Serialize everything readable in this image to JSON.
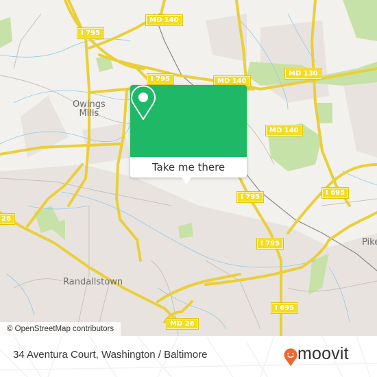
{
  "map": {
    "place_labels": [
      {
        "id": "owings-mills",
        "text": "Owings\nMills"
      },
      {
        "id": "randallstown",
        "text": "Randallstown"
      },
      {
        "id": "pikesville",
        "text": "Pike"
      }
    ],
    "road_shields": [
      {
        "id": "i795-a",
        "text": "I 795"
      },
      {
        "id": "md140-a",
        "text": "MD 140"
      },
      {
        "id": "i795-b",
        "text": "I 795"
      },
      {
        "id": "md140-b",
        "text": "MD 140"
      },
      {
        "id": "md130",
        "text": "MD 130"
      },
      {
        "id": "md140-c",
        "text": "MD 140"
      },
      {
        "id": "i795-c",
        "text": "I 795"
      },
      {
        "id": "i695-a",
        "text": "I 695"
      },
      {
        "id": "i795-d",
        "text": "I 795"
      },
      {
        "id": "md26-a",
        "text": "26"
      },
      {
        "id": "i695-b",
        "text": "I 695"
      },
      {
        "id": "md26-b",
        "text": "MD 26"
      }
    ],
    "attribution": "© OpenStreetMap contributors",
    "colors": {
      "base": "#f2f1ed",
      "road": "#f4dc1f",
      "park": "#c7e2a8",
      "residential": "#e9e3df",
      "water": "#8ec9ea"
    }
  },
  "popup": {
    "button_label": "Take me there",
    "icon": "map-pin-icon",
    "color": "#1eb866"
  },
  "footer": {
    "address": "34 Aventura Court, Washington / Baltimore",
    "brand": "moovit",
    "brand_color": "#f26531"
  }
}
